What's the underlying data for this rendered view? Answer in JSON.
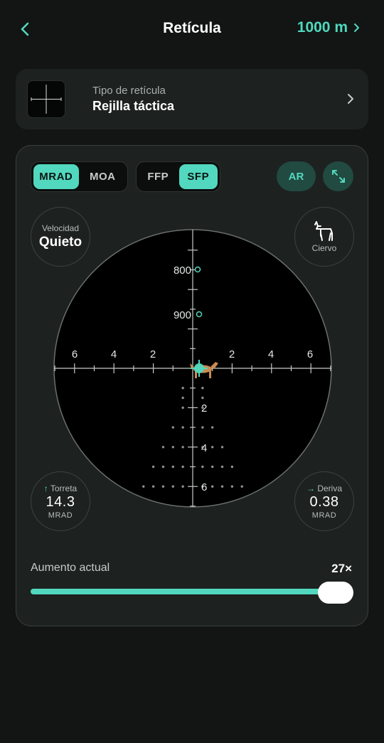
{
  "header": {
    "title": "Retícula",
    "range": "1000 m"
  },
  "reticle": {
    "label": "Tipo de retícula",
    "value": "Rejilla táctica"
  },
  "units": {
    "options": [
      "MRAD",
      "MOA"
    ],
    "selected": "MRAD"
  },
  "plane": {
    "options": [
      "FFP",
      "SFP"
    ],
    "selected": "SFP"
  },
  "ar_label": "AR",
  "velocity": {
    "label": "Velocidad",
    "value": "Quieto"
  },
  "target": {
    "label": "Ciervo"
  },
  "turret": {
    "label": "Torreta",
    "value": "14.3",
    "unit": "MRAD"
  },
  "drift": {
    "label": "Deriva",
    "value": "0.38",
    "unit": "MRAD"
  },
  "scope": {
    "range_marks": [
      "800",
      "900"
    ],
    "h_labels": [
      "6",
      "4",
      "2",
      "2",
      "4",
      "6"
    ],
    "v_labels": [
      "2",
      "4",
      "6"
    ]
  },
  "zoom": {
    "label": "Aumento actual",
    "value": "27×",
    "level": 0.96
  },
  "colors": {
    "accent": "#52d8be",
    "background": "#121514",
    "card": "#1d2120",
    "target": "#c98a52"
  }
}
